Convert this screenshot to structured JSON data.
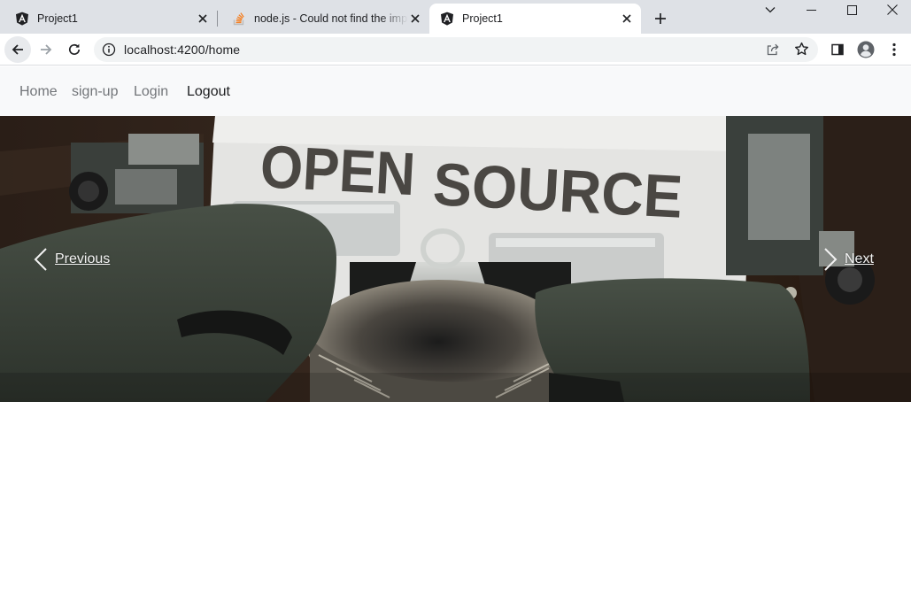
{
  "browser": {
    "tabs": [
      {
        "title": "Project1",
        "icon": "angular-icon",
        "active": false
      },
      {
        "title": "node.js - Could not find the implementation for builder",
        "icon": "stackoverflow-icon",
        "active": false
      },
      {
        "title": "Project1",
        "icon": "angular-icon",
        "active": true
      }
    ],
    "url": "localhost:4200/home"
  },
  "navbar": {
    "links": [
      "Home",
      "sign-up",
      "Login",
      "Logout"
    ]
  },
  "carousel": {
    "hero_text": "OPEN SOURCE",
    "prev_label": "Previous",
    "next_label": "Next"
  },
  "colors": {
    "tab_strip": "#dee1e6",
    "active_tab": "#ffffff",
    "navbar_bg": "#f8f9fa",
    "nav_link": "#727579",
    "nav_link_active": "#1c1d1f",
    "typewriter_green": "#3a4238"
  }
}
